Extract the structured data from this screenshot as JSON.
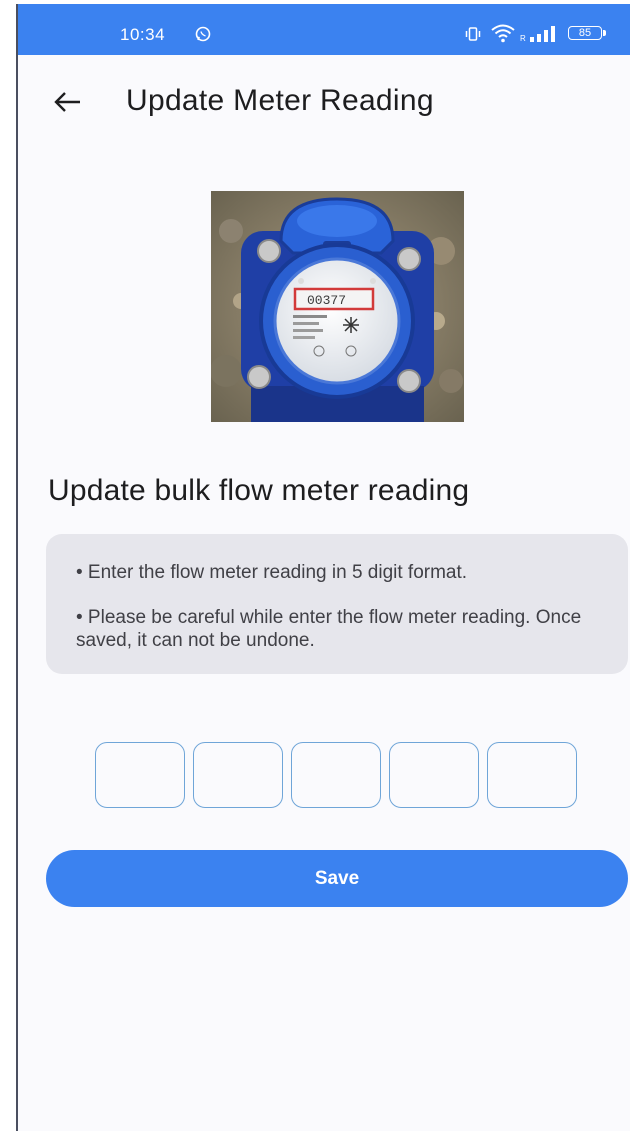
{
  "status_bar": {
    "time": "10:34",
    "battery": "85",
    "icons": [
      "whatsapp-icon",
      "vibrate-icon",
      "wifi-icon",
      "signal-icon",
      "battery-icon"
    ]
  },
  "header": {
    "title": "Update Meter Reading",
    "back_icon": "arrow-left-icon"
  },
  "meter_photo": {
    "reading_display": "00377"
  },
  "section": {
    "heading": "Update bulk flow meter reading"
  },
  "info": {
    "line1": "• Enter the flow meter reading in 5 digit format.",
    "line2": "• Please be careful while enter the flow meter reading. Once saved, it can not be undone."
  },
  "digits": [
    "",
    "",
    "",
    "",
    ""
  ],
  "actions": {
    "save_label": "Save"
  },
  "colors": {
    "accent": "#3b82f0",
    "card": "#e6e6ec",
    "input_border": "#6fa5d8"
  }
}
